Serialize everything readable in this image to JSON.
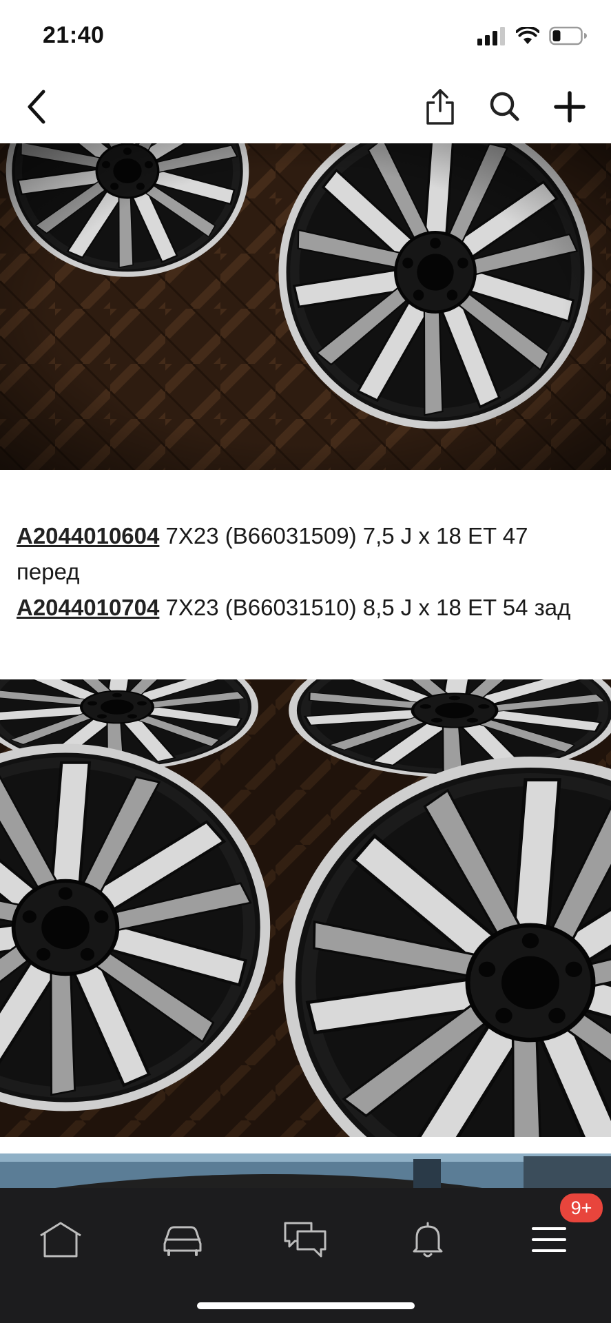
{
  "status_bar": {
    "time": "21:40",
    "icons": [
      "signal-icon",
      "wifi-icon",
      "battery-icon"
    ]
  },
  "nav": {
    "icons": [
      "back-chevron-icon",
      "share-icon",
      "search-icon",
      "plus-icon"
    ]
  },
  "article": {
    "lines": [
      {
        "part_number": "A2044010604",
        "text": " 7X23 (B66031509) 7,5 J x 18 ET 47 перед"
      },
      {
        "part_number": "A2044010704",
        "text": " 7X23 (B66031510) 8,5 J x 18 ET 54 зад"
      }
    ]
  },
  "tab_bar": {
    "tabs": [
      "home-icon",
      "car-icon",
      "messages-icon",
      "bell-icon",
      "menu-icon"
    ],
    "menu_badge": "9+"
  },
  "colors": {
    "tab_bar_bg": "#1c1c1e",
    "badge": "#e8453c",
    "floor": "#4a2e1a"
  }
}
